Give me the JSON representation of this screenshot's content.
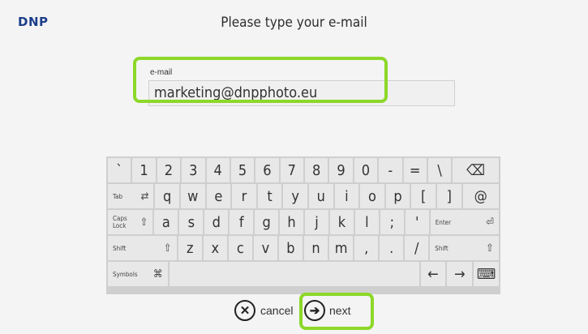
{
  "header": {
    "logo": "DNP",
    "title": "Please type your e-mail"
  },
  "email": {
    "label": "e-mail",
    "value": "marketing@dnpphoto.eu"
  },
  "keyboard": {
    "row1": [
      "`",
      "1",
      "2",
      "3",
      "4",
      "5",
      "6",
      "7",
      "8",
      "9",
      "0",
      "-",
      "=",
      "\\"
    ],
    "backspace": "⌫",
    "tab": {
      "label": "Tab",
      "sym": "⇄"
    },
    "row2": [
      "q",
      "w",
      "e",
      "r",
      "t",
      "y",
      "u",
      "i",
      "o",
      "p",
      "[",
      "]"
    ],
    "at": "@",
    "caps": {
      "label": "Caps Lock",
      "sym": "⇧"
    },
    "row3": [
      "a",
      "s",
      "d",
      "f",
      "g",
      "h",
      "j",
      "k",
      "l",
      ";",
      "'"
    ],
    "enter": {
      "label": "Enter",
      "sym": "⏎"
    },
    "shift_left": {
      "label": "Shift",
      "sym": "⇧"
    },
    "row4": [
      "z",
      "x",
      "c",
      "v",
      "b",
      "n",
      "m",
      ",",
      ".",
      "/"
    ],
    "shift_right": {
      "label": "Shift",
      "sym": "⇧"
    },
    "symbols": {
      "label": "Symbols",
      "sym": "⌘"
    },
    "arrow_left": "←",
    "arrow_right": "→",
    "keyboard_icon": "⌨"
  },
  "actions": {
    "cancel_label": "cancel",
    "next_label": "next",
    "cancel_icon": "✕",
    "next_icon": "➔"
  },
  "colors": {
    "highlight": "#8cd829",
    "logo": "#1d3f8a"
  }
}
